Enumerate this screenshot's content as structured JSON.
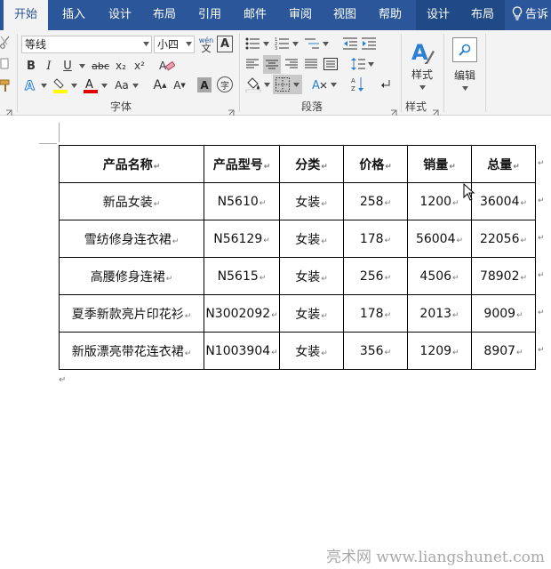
{
  "tabs": [
    {
      "label": "开始",
      "active": true
    },
    {
      "label": "插入"
    },
    {
      "label": "设计"
    },
    {
      "label": "布局"
    },
    {
      "label": "引用"
    },
    {
      "label": "邮件"
    },
    {
      "label": "审阅"
    },
    {
      "label": "视图"
    },
    {
      "label": "帮助"
    },
    {
      "label": "设计",
      "contextual": true
    },
    {
      "label": "布局",
      "contextual": true
    }
  ],
  "tell_me": "告诉",
  "ribbon": {
    "font_name": "等线",
    "font_size": "小四",
    "wen_glyph": "wén",
    "wen_char": "文",
    "a_box": "A",
    "bold": "B",
    "italic": "I",
    "underline": "U",
    "strike": "abc",
    "subscript": "x₂",
    "superscript": "x²",
    "change_case": "Aa",
    "grow_font": "A",
    "shrink_font": "A",
    "char_shading": "A",
    "enclose_char": "字",
    "groups": {
      "font": "字体",
      "paragraph": "段落",
      "styles": "样式"
    },
    "styles_button": "样式",
    "editing_button": "编辑"
  },
  "colors": {
    "tab_bar": "#2b579a",
    "ribbon_bg": "#f3f3f3",
    "highlight_yellow": "#ffff00",
    "font_red": "#e00000"
  },
  "table": {
    "headers": [
      "产品名称",
      "产品型号",
      "分类",
      "价格",
      "销量",
      "总量"
    ],
    "rows": [
      [
        "新品女装",
        "N5610",
        "女装",
        "258",
        "1200",
        "36004"
      ],
      [
        "雪纺修身连衣裙",
        "N56129",
        "女装",
        "178",
        "56004",
        "22056"
      ],
      [
        "高腰修身连裙",
        "N5615",
        "女装",
        "256",
        "4506",
        "78902"
      ],
      [
        "夏季新款亮片印花衫",
        "N3002092",
        "女装",
        "178",
        "2013",
        "9009"
      ],
      [
        "新版漂亮带花连衣裙",
        "N1003904",
        "女装",
        "356",
        "1209",
        "8907"
      ]
    ]
  },
  "watermark": "亮术网 www.liangshunet.com"
}
